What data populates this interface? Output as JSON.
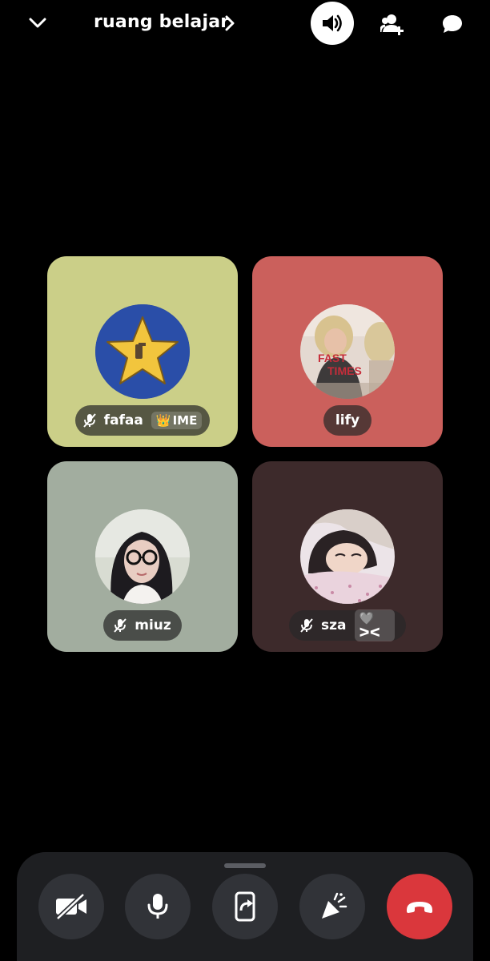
{
  "header": {
    "channel_name": "ruang belajar"
  },
  "participants": [
    {
      "name": "fafaa",
      "muted": true,
      "badge_text": "IME",
      "badge_emoji": "👑",
      "tile_color": "#cbcf88"
    },
    {
      "name": "lify",
      "muted": false,
      "tile_color": "#cb605c"
    },
    {
      "name": "miuz",
      "muted": true,
      "tile_color": "#a2ad9f"
    },
    {
      "name": "sza",
      "muted": true,
      "badge_text": "🩶ᐳᐸ",
      "tile_color": "#3d2a2b"
    }
  ],
  "controls": {
    "buttons": [
      "camera-off",
      "microphone",
      "screen-share",
      "activities",
      "hang-up"
    ],
    "hangup_color": "#da373c"
  },
  "icons": [
    "chevron-down-icon",
    "chevron-right-icon",
    "speaker-icon",
    "add-user-icon",
    "chat-bubble-icon",
    "mic-muted-icon"
  ]
}
